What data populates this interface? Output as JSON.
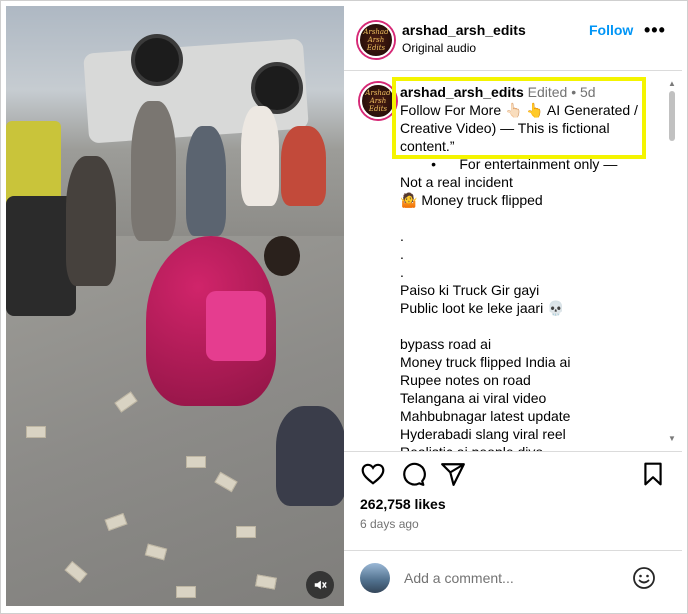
{
  "post": {
    "username": "arshad_arsh_edits",
    "audio": "Original audio",
    "follow_label": "Follow",
    "more_label": "•••",
    "avatar_text": "Arshad Arsh Edits"
  },
  "caption": {
    "username": "arshad_arsh_edits",
    "edited": "Edited",
    "dot": "•",
    "age": "5d",
    "lines": [
      "Follow For More 👆🏻 👆 AI Generated /",
      "Creative Video) — This is fictional",
      "content.”",
      "        •      For entertainment only —",
      "Not a real incident",
      "🤷 Money truck flipped",
      "",
      ".",
      ".",
      ".",
      "Paiso ki Truck Gir gayi",
      "Public loot ke leke jaari 💀",
      "",
      "bypass road ai",
      "Money truck flipped India ai",
      "Rupee notes on road",
      "Telangana ai viral video",
      "Mahbubnagar latest update",
      "Hyderabadi slang viral reel",
      "Realistic ai people divo"
    ]
  },
  "actions": {
    "like_icon": "heart-icon",
    "comment_icon": "comment-icon",
    "share_icon": "share-icon",
    "save_icon": "bookmark-icon"
  },
  "likes": "262,758 likes",
  "time": "6 days ago",
  "comment": {
    "placeholder": "Add a comment..."
  },
  "colors": {
    "accent": "#0095f6",
    "highlight": "#f4f400",
    "muted": "#737373"
  }
}
